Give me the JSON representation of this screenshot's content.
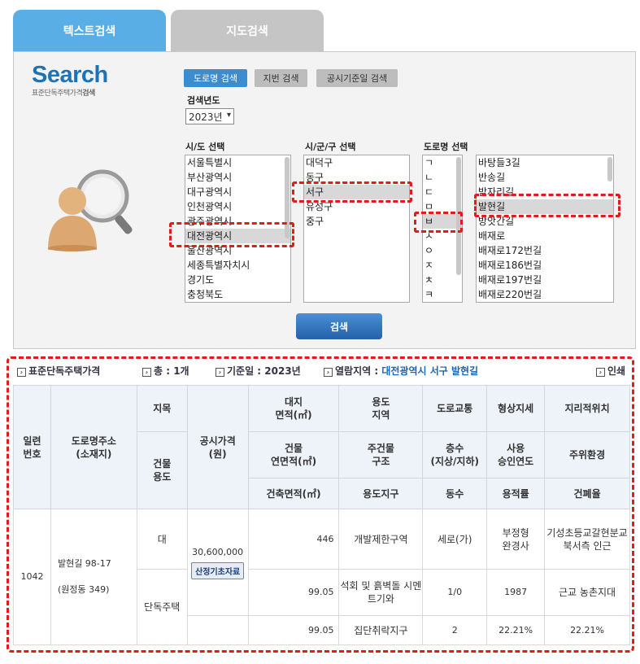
{
  "tabs": {
    "text_search": "텍스트검색",
    "map_search": "지도검색"
  },
  "logo": {
    "word": "Search",
    "sub_plain": "표준단독주택가격",
    "sub_bold": "검색"
  },
  "modes": {
    "road": "도로명 검색",
    "lot": "지번 검색",
    "date": "공시기준일 검색"
  },
  "year": {
    "label": "검색년도",
    "value": "2023년"
  },
  "sido": {
    "label": "시/도 선택",
    "items": [
      "서울특별시",
      "부산광역시",
      "대구광역시",
      "인천광역시",
      "광주광역시",
      "대전광역시",
      "울산광역시",
      "세종특별자치시",
      "경기도",
      "충청북도"
    ],
    "selected": "대전광역시"
  },
  "sigungu": {
    "label": "시/군/구 선택",
    "items": [
      "대덕구",
      "동구",
      "서구",
      "유성구",
      "중구"
    ],
    "selected": "서구"
  },
  "road": {
    "label": "도로명 선택",
    "initials": [
      "ㄱ",
      "ㄴ",
      "ㄷ",
      "ㅁ",
      "ㅂ",
      "ㅅ",
      "ㅇ",
      "ㅈ",
      "ㅊ",
      "ㅋ"
    ],
    "initial_selected": "ㅂ",
    "names": [
      "바탕들3길",
      "반송길",
      "받자리길",
      "발현길",
      "방앗간길",
      "배재로",
      "배재로172번길",
      "배재로186번길",
      "배재로197번길",
      "배재로220번길"
    ],
    "name_selected": "발현길"
  },
  "search_button": "검색",
  "info": {
    "title": "표준단독주택가격",
    "total": "총 : 1개",
    "date": "기준일 : 2023년",
    "area_label": "열람지역 :",
    "area": "대전광역시 서구 발현길",
    "print": "인쇄"
  },
  "headers": {
    "serial": "일련\n번호",
    "address": "도로명주소\n(소재지)",
    "jimok": "지목",
    "building_use": "건물\n용도",
    "price": "공시가격\n(원)",
    "land_area": "대지\n면적(㎡)",
    "zone": "용도\n지역",
    "road": "도로교통",
    "shape": "형상지세",
    "location": "지리적위치",
    "floor_area": "건물\n연면적(㎡)",
    "structure": "주건물\n구조",
    "floors": "층수\n(지상/지하)",
    "approval_year": "사용\n승인연도",
    "environment": "주위환경",
    "building_area": "건축면적(㎡)",
    "district": "용도지구",
    "dong_count": "동수",
    "far": "용적률",
    "bcr": "건폐율"
  },
  "row": {
    "serial": "1042",
    "road_address": "발현길 98-17",
    "lot_address": "(원정동 349)",
    "jimok": "대",
    "building_use": "단독주택",
    "price": "30,600,000",
    "calc_button": "산정기초자료",
    "land_area": "446",
    "zone": "개발제한구역",
    "road": "세로(가)",
    "shape": "부정형\n완경사",
    "location": "기성초등교갈현분교\n북서측 인근",
    "floor_area": "99.05",
    "structure": "석회 및 흙벽돌 시멘트기와",
    "floors": "1/0",
    "approval_year": "1987",
    "environment": "근교 농촌지대",
    "building_area": "99.05",
    "district": "집단취락지구",
    "dong_count": "2",
    "far": "22.21%",
    "bcr": "22.21%"
  }
}
